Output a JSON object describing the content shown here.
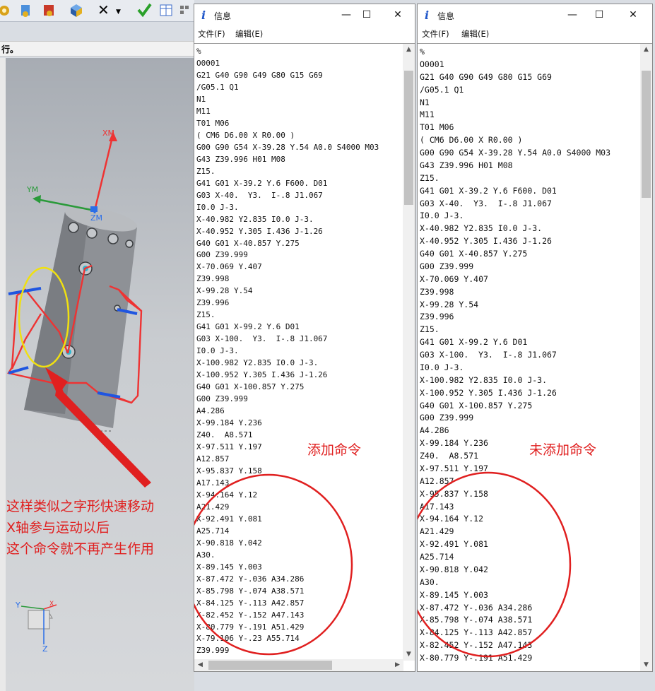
{
  "cam": {
    "status_text": "行。",
    "axis_labels": {
      "xm": "XM",
      "ym": "YM",
      "zm": "ZM",
      "tri_x": "X",
      "tri_y": "Y",
      "tri_z": "Z"
    },
    "note": [
      "这样类似之字形快速移动",
      "X轴参与运动以后",
      "这个命令就不再产生作用"
    ]
  },
  "window_left": {
    "title": "信息",
    "title_icon": "i",
    "menu": [
      "文件(F)",
      "编辑(E)"
    ],
    "controls": [
      "—",
      "☐",
      "✕"
    ],
    "annotation": "添加命令",
    "lines": [
      "%",
      "O0001",
      "G21 G40 G90 G49 G80 G15 G69",
      "/G05.1 Q1",
      "N1",
      "M11",
      "T01 M06",
      "( CM6 D6.00 X R0.00 )",
      "G00 G90 G54 X-39.28 Y.54 A0.0 S4000 M03",
      "G43 Z39.996 H01 M08",
      "Z15.",
      "G41 G01 X-39.2 Y.6 F600. D01",
      "G03 X-40.  Y3.  I-.8 J1.067",
      "I0.0 J-3.",
      "X-40.982 Y2.835 I0.0 J-3.",
      "X-40.952 Y.305 I.436 J-1.26",
      "G40 G01 X-40.857 Y.275",
      "G00 Z39.999",
      "X-70.069 Y.407",
      "Z39.998",
      "X-99.28 Y.54",
      "Z39.996",
      "Z15.",
      "G41 G01 X-99.2 Y.6 D01",
      "G03 X-100.  Y3.  I-.8 J1.067",
      "I0.0 J-3.",
      "X-100.982 Y2.835 I0.0 J-3.",
      "X-100.952 Y.305 I.436 J-1.26",
      "G40 G01 X-100.857 Y.275",
      "G00 Z39.999",
      "A4.286",
      "X-99.184 Y.236",
      "Z40.  A8.571",
      "X-97.511 Y.197",
      "A12.857",
      "X-95.837 Y.158",
      "A17.143",
      "X-94.164 Y.12",
      "A21.429",
      "X-92.491 Y.081",
      "A25.714",
      "X-90.818 Y.042",
      "A30.",
      "X-89.145 Y.003",
      "X-87.472 Y-.036 A34.286",
      "X-85.798 Y-.074 A38.571",
      "X-84.125 Y-.113 A42.857",
      "X-82.452 Y-.152 A47.143",
      "X-80.779 Y-.191 A51.429",
      "X-79.106 Y-.23 A55.714",
      "Z39.999"
    ]
  },
  "window_right": {
    "title": "信息",
    "title_icon": "i",
    "menu": [
      "文件(F)",
      "编辑(E)"
    ],
    "controls": [
      "—",
      "☐",
      "✕"
    ],
    "annotation": "未添加命令",
    "lines": [
      "%",
      "O0001",
      "G21 G40 G90 G49 G80 G15 G69",
      "/G05.1 Q1",
      "N1",
      "M11",
      "T01 M06",
      "( CM6 D6.00 X R0.00 )",
      "G00 G90 G54 X-39.28 Y.54 A0.0 S4000 M03",
      "G43 Z39.996 H01 M08",
      "Z15.",
      "G41 G01 X-39.2 Y.6 F600. D01",
      "G03 X-40.  Y3.  I-.8 J1.067",
      "I0.0 J-3.",
      "X-40.982 Y2.835 I0.0 J-3.",
      "X-40.952 Y.305 I.436 J-1.26",
      "G40 G01 X-40.857 Y.275",
      "G00 Z39.999",
      "X-70.069 Y.407",
      "Z39.998",
      "X-99.28 Y.54",
      "Z39.996",
      "Z15.",
      "G41 G01 X-99.2 Y.6 D01",
      "G03 X-100.  Y3.  I-.8 J1.067",
      "I0.0 J-3.",
      "X-100.982 Y2.835 I0.0 J-3.",
      "X-100.952 Y.305 I.436 J-1.26",
      "G40 G01 X-100.857 Y.275",
      "G00 Z39.999",
      "A4.286",
      "X-99.184 Y.236",
      "Z40.  A8.571",
      "X-97.511 Y.197",
      "A12.857",
      "X-95.837 Y.158",
      "A17.143",
      "X-94.164 Y.12",
      "A21.429",
      "X-92.491 Y.081",
      "A25.714",
      "X-90.818 Y.042",
      "A30.",
      "X-89.145 Y.003",
      "X-87.472 Y-.036 A34.286",
      "X-85.798 Y-.074 A38.571",
      "X-84.125 Y-.113 A42.857",
      "X-82.452 Y-.152 A47.143",
      "X-80.779 Y-.191 A51.429"
    ]
  },
  "colors": {
    "annotation_red": "#e02020",
    "axis_red": "#e33",
    "axis_green": "#2a9a3a",
    "axis_blue": "#2a6ee8",
    "highlight_yellow": "#f0e010"
  }
}
